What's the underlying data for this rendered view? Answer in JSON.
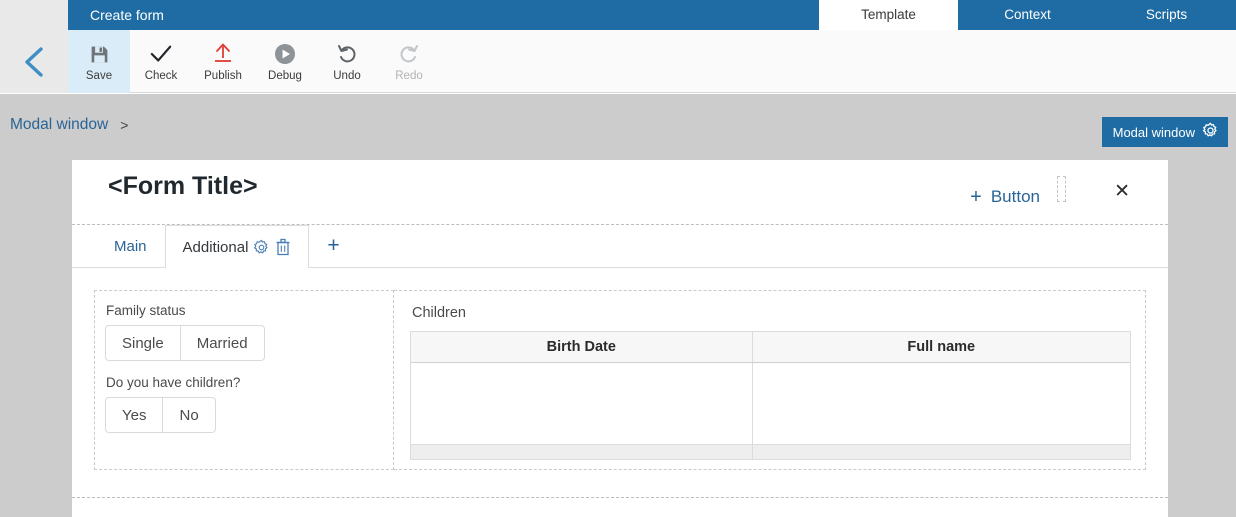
{
  "header": {
    "app_title": "Create form",
    "tabs": [
      {
        "label": "Template",
        "active": true
      },
      {
        "label": "Context",
        "active": false
      },
      {
        "label": "Scripts",
        "active": false
      }
    ],
    "accent_blue": "#1f6ca4"
  },
  "toolbar": {
    "back_icon": "chevron-left-icon",
    "buttons": [
      {
        "label": "Save",
        "icon": "floppy-disk-icon",
        "active": true,
        "disabled": false
      },
      {
        "label": "Check",
        "icon": "checkmark-icon",
        "active": false,
        "disabled": false
      },
      {
        "label": "Publish",
        "icon": "upload-arrow-icon",
        "active": false,
        "disabled": false
      },
      {
        "label": "Debug",
        "icon": "play-circle-icon",
        "active": false,
        "disabled": false
      },
      {
        "label": "Undo",
        "icon": "undo-arrow-icon",
        "active": false,
        "disabled": false
      },
      {
        "label": "Redo",
        "icon": "redo-arrow-icon",
        "active": false,
        "disabled": true
      }
    ]
  },
  "canvas": {
    "breadcrumb": {
      "label": "Modal window",
      "separator": ">"
    },
    "badge": {
      "label": "Modal window",
      "icon": "gear-icon"
    }
  },
  "form": {
    "title": "<Form Title>",
    "add_button": {
      "plus": "+",
      "label": "Button"
    },
    "close_icon": "close-icon",
    "tabs": [
      {
        "label": "Main",
        "active": false,
        "icons": []
      },
      {
        "label": "Additional",
        "active": true,
        "icons": [
          "gear-icon",
          "trash-icon"
        ]
      }
    ],
    "add_tab": "+",
    "left_box": {
      "fields": [
        {
          "label": "Family status",
          "options": [
            "Single",
            "Married"
          ]
        },
        {
          "label": "Do you have children?",
          "options": [
            "Yes",
            "No"
          ]
        }
      ]
    },
    "right_box": {
      "title": "Children",
      "columns": [
        "Birth Date",
        "Full name"
      ],
      "rows": []
    }
  }
}
